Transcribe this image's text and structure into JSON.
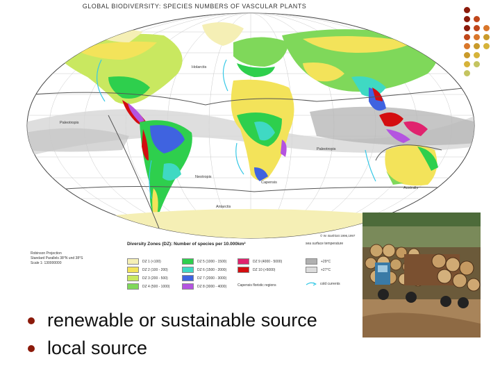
{
  "map": {
    "title": "GLOBAL BIODIVERSITY:  SPECIES NUMBERS OF VASCULAR PLANTS",
    "regions": [
      "Holarctis",
      "Paleotropis",
      "Paleotropis",
      "Neotropis",
      "Capensis",
      "Australis",
      "Antarctis"
    ],
    "credit": "© W. Barthlott 1996,1997",
    "projection_lines": [
      "Robinson Projection",
      "Standard Parallels 38°N und 38°S",
      "Scale 1: 130000000"
    ],
    "legend_title": "Diversity Zones (DZ): Number of species per 10.000km²",
    "zones": [
      {
        "label": "DZ 1     (<100)",
        "color": "#f5efb5"
      },
      {
        "label": "DZ 2     (100 - 200)",
        "color": "#f3e35a"
      },
      {
        "label": "DZ 3     (200 -  500)",
        "color": "#c9e860"
      },
      {
        "label": "DZ 4     (500 - 1000)",
        "color": "#7fd85a"
      },
      {
        "label": "DZ 5     (1000 - 1500)",
        "color": "#2ecf4d"
      },
      {
        "label": "DZ 6     (1500 - 2000)",
        "color": "#3fd9c3"
      },
      {
        "label": "DZ 7     (2000 - 3000)",
        "color": "#3f63e0"
      },
      {
        "label": "DZ 8     (3000 - 4000)",
        "color": "#b454e0"
      },
      {
        "label": "DZ 9     (4000 - 5000)",
        "color": "#e0236e"
      },
      {
        "label": "DZ 10   (>5000)",
        "color": "#d40d10"
      }
    ],
    "floristic_label": "Capensis      floristic regions",
    "sea_title": "sea surface temperature",
    "sea_items": [
      {
        "label": "+29°C",
        "color": "#b0b0b0"
      },
      {
        "label": "+27°C",
        "color": "#dcdcdc"
      },
      {
        "label": "cold currents",
        "color": "#35c8e6"
      }
    ]
  },
  "bullets": [
    "renewable or sustainable source",
    "local source"
  ],
  "colors": {
    "bullet": "#8b1a0a"
  },
  "decor_dots": [
    "#8b1a0a",
    "#c0461a",
    "#d9762a",
    "#c99a2a",
    "#d6b33a",
    "#c4c460"
  ]
}
